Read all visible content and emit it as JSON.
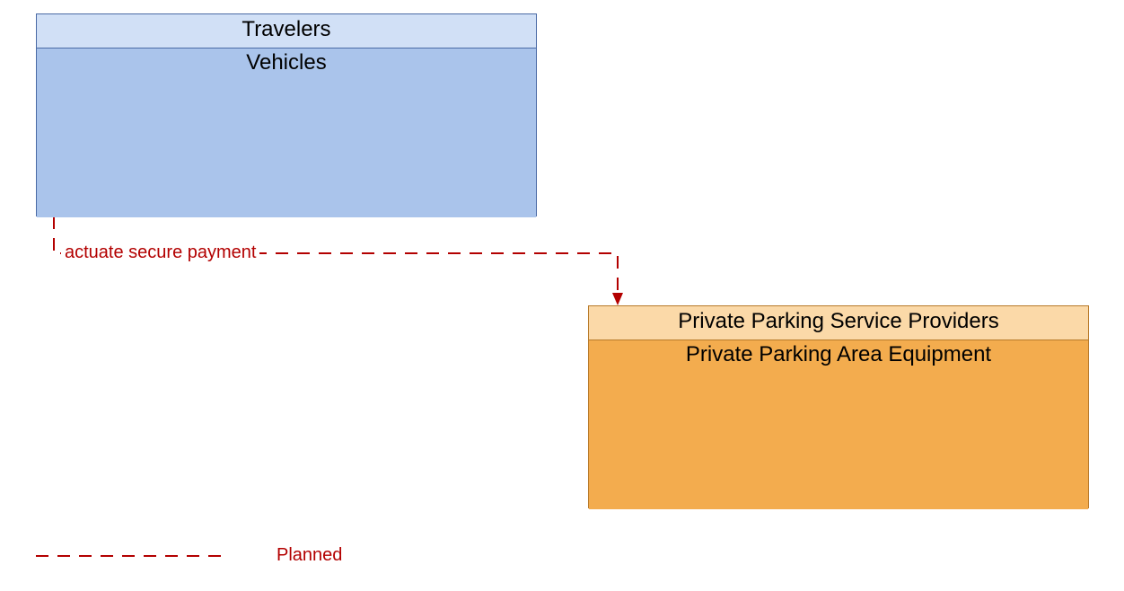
{
  "boxes": {
    "travelers": {
      "header": "Travelers",
      "body": "Vehicles"
    },
    "parking": {
      "header": "Private Parking Service Providers",
      "body": "Private Parking Area Equipment"
    }
  },
  "flow": {
    "label": "actuate secure payment"
  },
  "legend": {
    "planned": "Planned"
  },
  "colors": {
    "flow_line": "#b30000",
    "box1_header_bg": "#d1e0f6",
    "box1_body_bg": "#aac4eb",
    "box1_border": "#4a6aa5",
    "box2_header_bg": "#fbd9a8",
    "box2_body_bg": "#f3ac4e",
    "box2_border": "#b87a2a"
  }
}
